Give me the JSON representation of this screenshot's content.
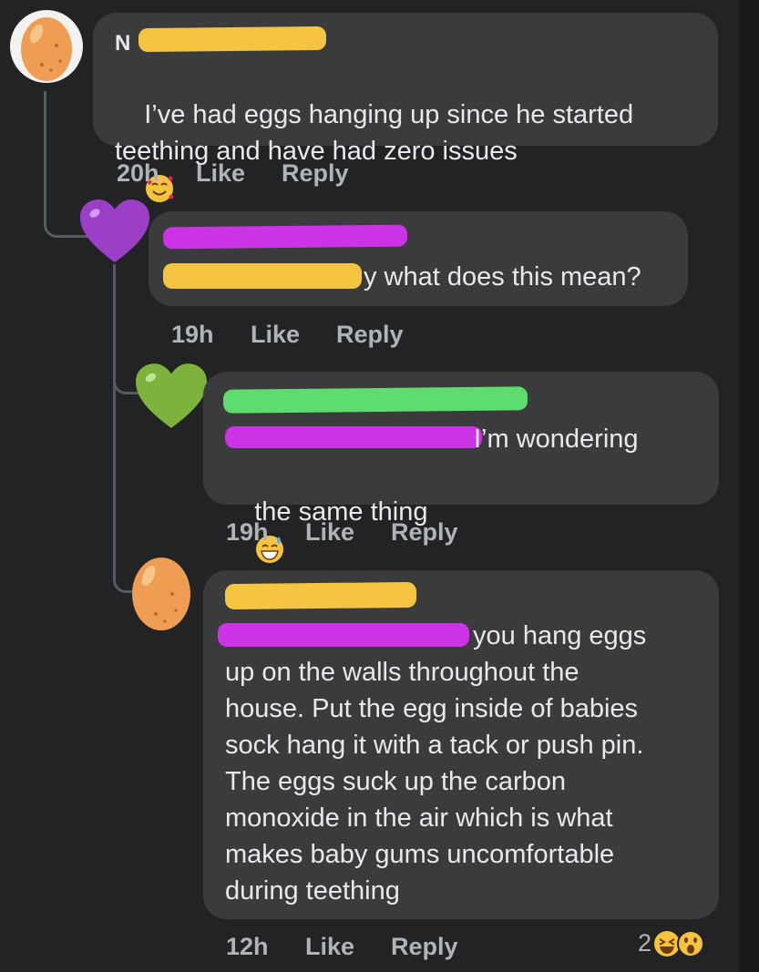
{
  "comments": [
    {
      "id": "c1",
      "author_visible": "N",
      "text": "I’ve had eggs hanging up since he started teething and have had zero issues",
      "emoji": "smiling-face-with-hearts",
      "time": "20h",
      "like_label": "Like",
      "reply_label": "Reply",
      "avatar": "egg-icon"
    },
    {
      "id": "c2",
      "text_tail": "y what does this mean?",
      "time": "19h",
      "like_label": "Like",
      "reply_label": "Reply",
      "avatar": "purple-heart-icon"
    },
    {
      "id": "c3",
      "text_tail_line1": "I’m wondering",
      "text_line2": "the same thing",
      "emoji": "grinning-face-with-sweat",
      "time": "19h",
      "like_label": "Like",
      "reply_label": "Reply",
      "avatar": "green-heart-icon"
    },
    {
      "id": "c4",
      "text_tail_line1": "you hang eggs",
      "text_rest": "up on the walls throughout the\nhouse. Put the egg inside of babies\nsock hang it with a tack or push pin.\nThe eggs suck up the carbon\nmonoxide in the air which is what\nmakes baby gums uncomfortable\nduring teething",
      "time": "12h",
      "like_label": "Like",
      "reply_label": "Reply",
      "reaction_count": "2",
      "avatar": "egg-icon"
    }
  ],
  "colors": {
    "background": "#222325",
    "bubble": "#3a3b3c",
    "redact_yellow": "#f5c542",
    "redact_purple": "#cc33e6",
    "redact_green": "#5fdc6e"
  }
}
